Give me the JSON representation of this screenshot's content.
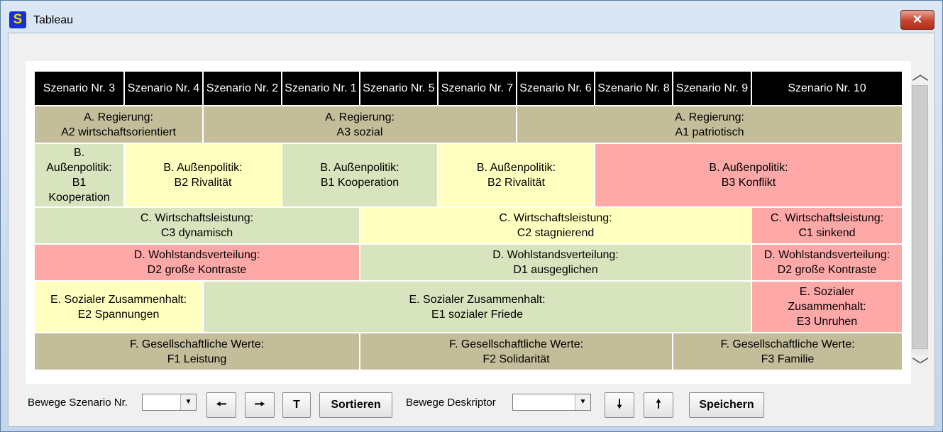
{
  "window": {
    "title": "Tableau",
    "app_icon_glyph": "S",
    "close_glyph": "✕"
  },
  "header": [
    "Szenario Nr. 3",
    "Szenario Nr. 4",
    "Szenario Nr. 2",
    "Szenario Nr. 1",
    "Szenario Nr. 5",
    "Szenario Nr. 7",
    "Szenario Nr. 6",
    "Szenario Nr. 8",
    "Szenario Nr. 9",
    "Szenario Nr. 10"
  ],
  "rows": [
    [
      {
        "text": "A. Regierung:\nA2 wirtschaftsorientiert",
        "start": 0,
        "span": 2,
        "color": "tan"
      },
      {
        "text": "A. Regierung:\nA3 sozial",
        "start": 2,
        "span": 4,
        "color": "tan"
      },
      {
        "text": "A. Regierung:\nA1 patriotisch",
        "start": 6,
        "span": 4,
        "color": "tan"
      }
    ],
    [
      {
        "text": "B.\nAußenpolitik:\nB1\nKooperation",
        "start": 0,
        "span": 1,
        "color": "green"
      },
      {
        "text": "B. Außenpolitik:\nB2 Rivalität",
        "start": 1,
        "span": 2,
        "color": "yellow"
      },
      {
        "text": "B. Außenpolitik:\nB1 Kooperation",
        "start": 3,
        "span": 2,
        "color": "green"
      },
      {
        "text": "B. Außenpolitik:\nB2 Rivalität",
        "start": 5,
        "span": 2,
        "color": "yellow"
      },
      {
        "text": "B. Außenpolitik:\nB3 Konflikt",
        "start": 7,
        "span": 3,
        "color": "red"
      }
    ],
    [
      {
        "text": "C. Wirtschaftsleistung:\nC3 dynamisch",
        "start": 0,
        "span": 4,
        "color": "green"
      },
      {
        "text": "C. Wirtschaftsleistung:\nC2 stagnierend",
        "start": 4,
        "span": 5,
        "color": "yellow"
      },
      {
        "text": "C. Wirtschaftsleistung:\nC1 sinkend",
        "start": 9,
        "span": 1,
        "color": "red"
      }
    ],
    [
      {
        "text": "D. Wohlstandsverteilung:\nD2 große Kontraste",
        "start": 0,
        "span": 4,
        "color": "red"
      },
      {
        "text": "D. Wohlstandsverteilung:\nD1 ausgeglichen",
        "start": 4,
        "span": 5,
        "color": "green"
      },
      {
        "text": "D. Wohlstandsverteilung:\nD2 große Kontraste",
        "start": 9,
        "span": 1,
        "color": "red"
      }
    ],
    [
      {
        "text": "E. Sozialer Zusammenhalt:\nE2 Spannungen",
        "start": 0,
        "span": 2,
        "color": "yellow"
      },
      {
        "text": "E. Sozialer Zusammenhalt:\nE1 sozialer Friede",
        "start": 2,
        "span": 7,
        "color": "green"
      },
      {
        "text": "E. Sozialer\nZusammenhalt:\nE3 Unruhen",
        "start": 9,
        "span": 1,
        "color": "red"
      }
    ],
    [
      {
        "text": "F. Gesellschaftliche Werte:\nF1 Leistung",
        "start": 0,
        "span": 4,
        "color": "tan"
      },
      {
        "text": "F. Gesellschaftliche Werte:\nF2 Solidarität",
        "start": 4,
        "span": 4,
        "color": "tan"
      },
      {
        "text": "F. Gesellschaftliche Werte:\nF3 Familie",
        "start": 8,
        "span": 2,
        "color": "tan"
      }
    ]
  ],
  "controls": {
    "move_scenario_label": "Bewege Szenario Nr.",
    "move_scenario_value": "",
    "left_glyph": "🠔",
    "right_glyph": "🠖",
    "t_label": "T",
    "sort_label": "Sortieren",
    "move_descriptor_label": "Bewege Deskriptor",
    "move_descriptor_value": "",
    "down_glyph": "🠗",
    "up_glyph": "🠕",
    "save_label": "Speichern",
    "dropdown_glyph": "▼"
  },
  "scrollbar": {
    "up_glyph": "︿",
    "down_glyph": "﹀"
  },
  "colors": {
    "header": "#000000",
    "tan": "#c4bd9a",
    "green": "#d7e4bd",
    "yellow": "#ffffbf",
    "red": "#ffa8a8"
  }
}
